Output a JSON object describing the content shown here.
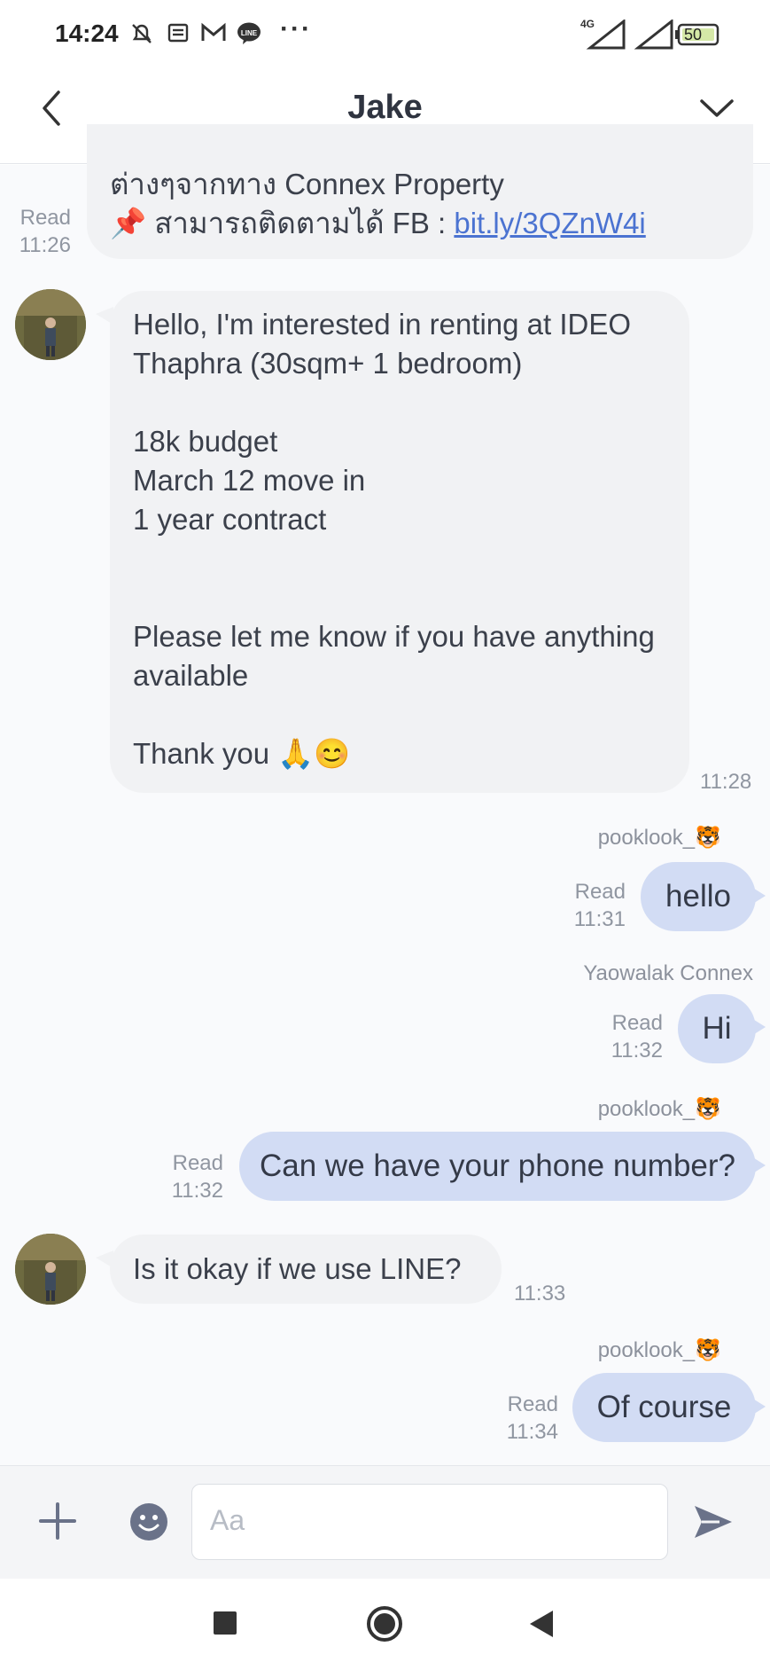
{
  "status_bar": {
    "time": "14:24",
    "network": "4G",
    "battery": "50"
  },
  "header": {
    "title": "Jake"
  },
  "messages": [
    {
      "line1": "ต่างๆจากทาง Connex Property",
      "line2_prefix": "📌 สามารถติดตามได้ FB : ",
      "link": "bit.ly/3QZnW4i",
      "read": "Read",
      "time": "11:26"
    },
    {
      "text": "Hello, I'm interested in renting at IDEO Thaphra (30sqm+ 1 bedroom)\n\n18k budget\nMarch 12 move in\n1 year contract\n\n\nPlease let me know if you have anything available\n\nThank you 🙏😊",
      "time": "11:28"
    },
    {
      "sender": "pooklook_🐯",
      "text": "hello",
      "read": "Read",
      "time": "11:31"
    },
    {
      "sender": "Yaowalak Connex",
      "text": "Hi",
      "read": "Read",
      "time": "11:32"
    },
    {
      "sender": "pooklook_🐯",
      "text": "Can we have your phone number?",
      "read": "Read",
      "time": "11:32"
    },
    {
      "text": "Is it okay if we use LINE?",
      "time": "11:33"
    },
    {
      "sender": "pooklook_🐯",
      "text": "Of course",
      "read": "Read",
      "time": "11:34"
    }
  ],
  "input": {
    "placeholder": "Aa"
  },
  "colors": {
    "outgoing_bubble": "#d2dcf4",
    "incoming_bubble": "#f1f2f4",
    "link": "#4b73d1",
    "icon": "#6a7289"
  }
}
